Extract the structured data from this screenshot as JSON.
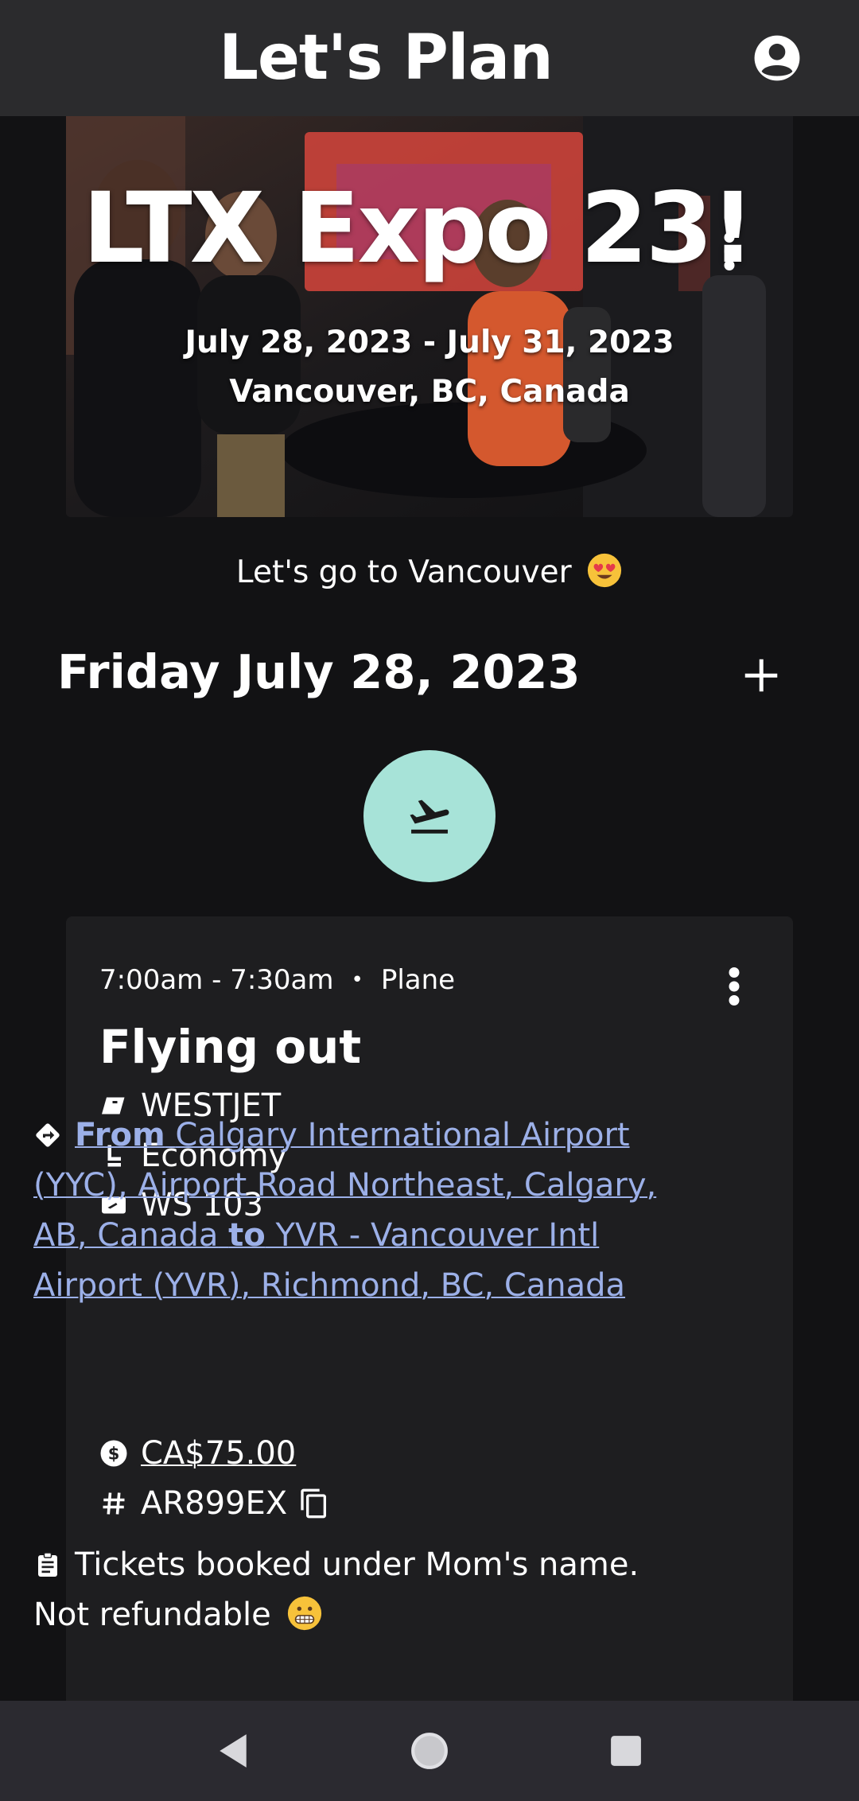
{
  "app_bar": {
    "title": "Let's Plan",
    "account_icon": "account-circle-icon"
  },
  "hero": {
    "title": "LTX Expo 23!",
    "dates": "July 28, 2023 - July 31, 2023",
    "location": "Vancouver, BC, Canada",
    "menu_icon": "more-vert-icon"
  },
  "subtitle": {
    "text": "Let's go to Vancouver",
    "emoji": "heart-eyes-emoji"
  },
  "day": {
    "title": "Friday July 28, 2023",
    "add_icon": "plus-icon"
  },
  "category_button": {
    "icon": "flight-takeoff-icon",
    "color": "#a7e3d8"
  },
  "card": {
    "time": "7:00am - 7:30am",
    "type": "Plane",
    "title": "Flying out",
    "airline": "WESTJET",
    "class": "Economy",
    "flight_number": "WS 103",
    "route": {
      "from_label": "From",
      "from": "Calgary International Airport (YYC), Airport Road Northeast, Calgary, AB, Canada",
      "to_label": "to",
      "to": "YVR - Vancouver Intl Airport (YVR), Richmond, BC, Canada"
    },
    "price": "CA$75.00",
    "confirmation": "AR899EX",
    "note": "Tickets booked under Mom's name. Not refundable",
    "note_emoji": "grimacing-emoji",
    "link_color": "#9cb0e8"
  },
  "nav_bar": {
    "back_icon": "back-triangle-icon",
    "home_icon": "home-circle-icon",
    "recents_icon": "recents-square-icon"
  }
}
